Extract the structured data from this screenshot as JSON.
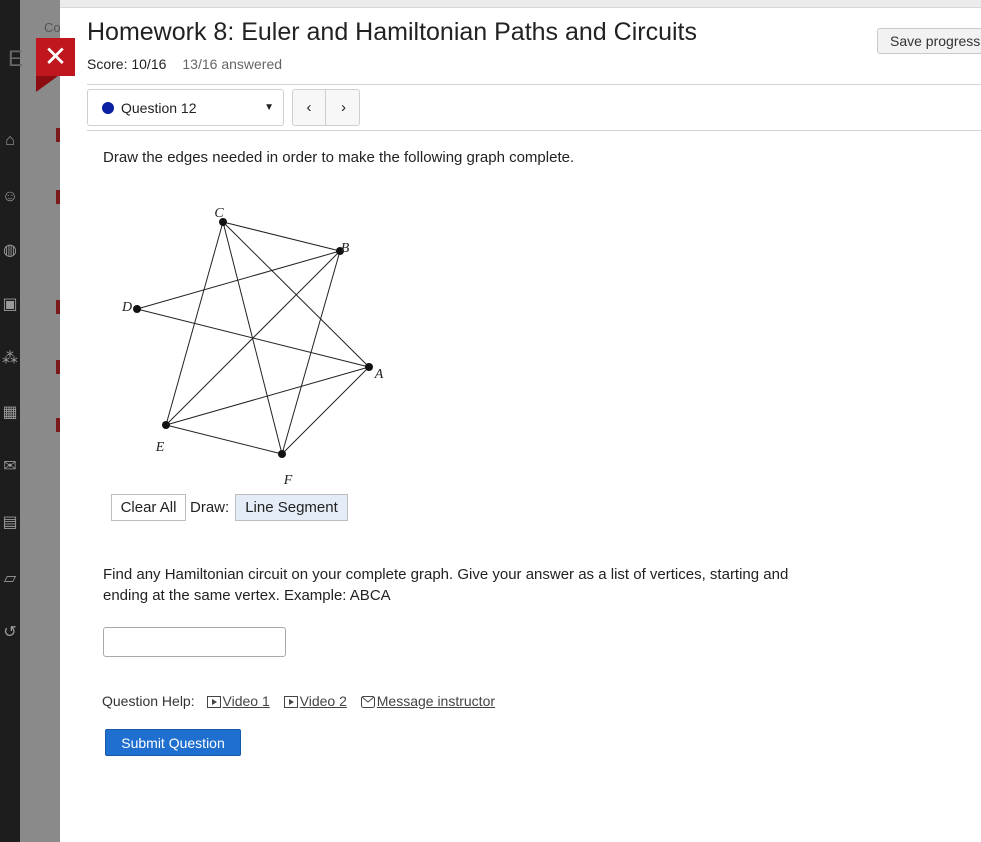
{
  "background": {
    "course_fragment": "Co",
    "side_letter": "E"
  },
  "header": {
    "title": "Homework 8: Euler and Hamiltonian Paths and Circuits",
    "score": "Score: 10/16",
    "answered": "13/16 answered",
    "save_label": "Save progress",
    "close_glyph": "✕"
  },
  "question_nav": {
    "selected": "Question 12",
    "status_color": "#0c1fa3",
    "prev_glyph": "‹",
    "next_glyph": "›"
  },
  "question": {
    "prompt": "Draw the edges needed in order to make the following graph complete.",
    "graph": {
      "vertex_labels": [
        "A",
        "B",
        "C",
        "D",
        "E",
        "F"
      ],
      "edges": [
        [
          "C",
          "B"
        ],
        [
          "C",
          "A"
        ],
        [
          "C",
          "E"
        ],
        [
          "C",
          "F"
        ],
        [
          "B",
          "D"
        ],
        [
          "B",
          "E"
        ],
        [
          "B",
          "F"
        ],
        [
          "D",
          "A"
        ],
        [
          "A",
          "E"
        ],
        [
          "A",
          "F"
        ],
        [
          "E",
          "F"
        ]
      ]
    },
    "clear_label": "Clear All",
    "draw_label": "Draw:",
    "tool_label": "Line Segment",
    "prompt2": "Find any Hamiltonian circuit on your complete graph. Give your answer as a list of vertices, starting and ending at the same vertex. Example: ABCA",
    "answer_value": "",
    "help_label": "Question Help:",
    "video1": "Video 1",
    "video2": "Video 2",
    "message": "Message instructor",
    "submit_label": "Submit Question"
  },
  "colors": {
    "close": "#c0161d",
    "submit": "#1e6fcf",
    "tool_active_bg": "#e4edf7"
  }
}
